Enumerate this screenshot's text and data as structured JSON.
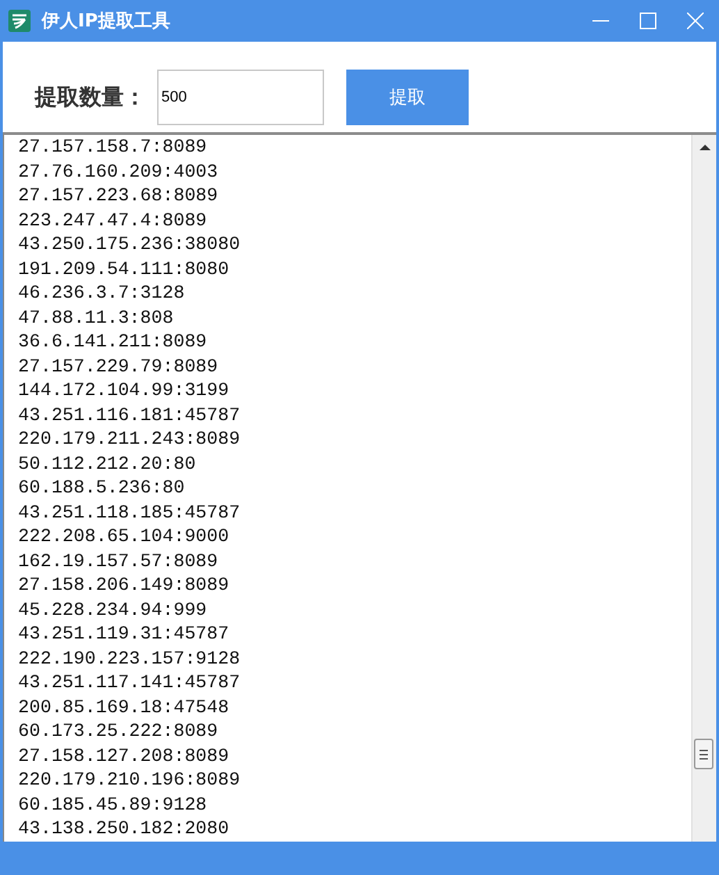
{
  "window": {
    "title": "伊人IP提取工具"
  },
  "form": {
    "label": "提取数量：",
    "quantity": "500",
    "button": "提取"
  },
  "output_lines": [
    "27.157.158.7:8089",
    "27.76.160.209:4003",
    "27.157.223.68:8089",
    "223.247.47.4:8089",
    "43.250.175.236:38080",
    "191.209.54.111:8080",
    "46.236.3.7:3128",
    "47.88.11.3:808",
    "36.6.141.211:8089",
    "27.157.229.79:8089",
    "144.172.104.99:3199",
    "43.251.116.181:45787",
    "220.179.211.243:8089",
    "50.112.212.20:80",
    "60.188.5.236:80",
    "43.251.118.185:45787",
    "222.208.65.104:9000",
    "162.19.157.57:8089",
    "27.158.206.149:8089",
    "45.228.234.94:999",
    "43.251.119.31:45787",
    "222.190.223.157:9128",
    "43.251.117.141:45787",
    "200.85.169.18:47548",
    "60.173.25.222:8089",
    "27.158.127.208:8089",
    "220.179.210.196:8089",
    "60.185.45.89:9128",
    "43.138.250.182:2080"
  ]
}
